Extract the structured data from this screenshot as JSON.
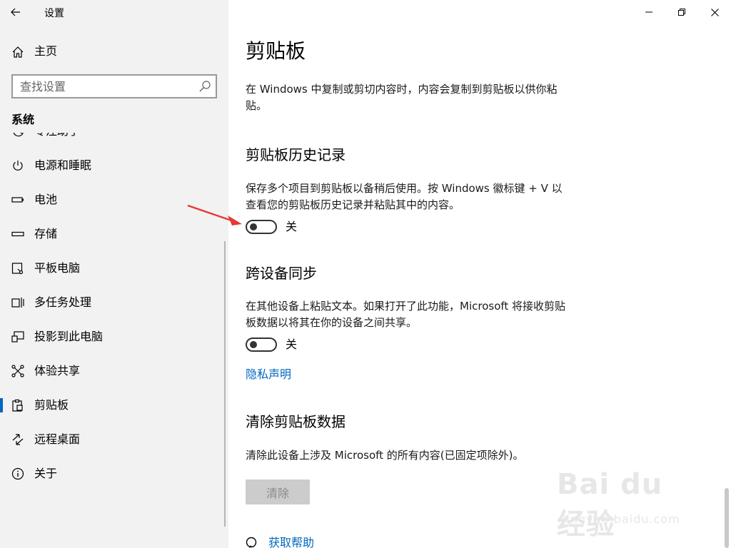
{
  "window": {
    "title": "设置",
    "controls": {
      "minimize": "minimize-icon",
      "restore": "restore-icon",
      "close": "close-icon"
    }
  },
  "sidebar": {
    "home_label": "主页",
    "search_placeholder": "查找设置",
    "section_label": "系统",
    "items": [
      {
        "label": "专注助手",
        "icon": "moon-icon"
      },
      {
        "label": "电源和睡眠",
        "icon": "power-icon"
      },
      {
        "label": "电池",
        "icon": "battery-icon"
      },
      {
        "label": "存储",
        "icon": "storage-icon"
      },
      {
        "label": "平板电脑",
        "icon": "tablet-icon"
      },
      {
        "label": "多任务处理",
        "icon": "multitask-icon"
      },
      {
        "label": "投影到此电脑",
        "icon": "project-icon"
      },
      {
        "label": "体验共享",
        "icon": "share-icon"
      },
      {
        "label": "剪贴板",
        "icon": "clipboard-icon",
        "active": true
      },
      {
        "label": "远程桌面",
        "icon": "remote-desktop-icon"
      },
      {
        "label": "关于",
        "icon": "info-icon"
      }
    ]
  },
  "main": {
    "title": "剪贴板",
    "intro": "在 Windows 中复制或剪切内容时，内容会复制到剪贴板以供你粘贴。",
    "history": {
      "heading": "剪贴板历史记录",
      "description": "保存多个项目到剪贴板以备稍后使用。按 Windows 徽标键 + V 以查看您的剪贴板历史记录并粘贴其中的内容。",
      "toggle_state": "关"
    },
    "sync": {
      "heading": "跨设备同步",
      "description": "在其他设备上粘贴文本。如果打开了此功能，Microsoft 将接收剪贴板数据以将其在你的设备之间共享。",
      "toggle_state": "关",
      "privacy_link": "隐私声明"
    },
    "clear": {
      "heading": "清除剪贴板数据",
      "description": "清除此设备上涉及 Microsoft 的所有内容(已固定项除外)。",
      "button": "清除"
    },
    "help_link": "获取帮助"
  },
  "colors": {
    "accent": "#0067c0",
    "sidebar_bg": "#f2f2f2",
    "annotation": "#e53935"
  },
  "watermark": {
    "logo": "Bai du 经验",
    "url": "jingyan.baidu.com"
  }
}
